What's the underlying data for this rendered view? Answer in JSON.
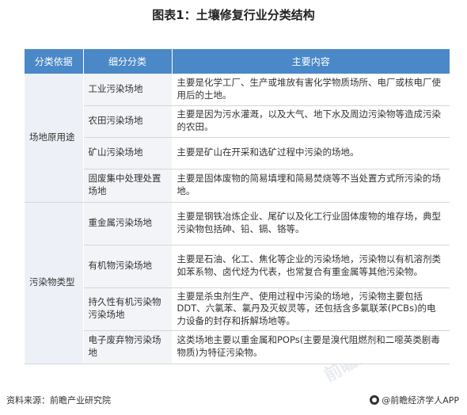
{
  "title": "图表1：土壤修复行业分类结构",
  "table": {
    "headers": [
      "分类依据",
      "细分分类",
      "主要内容"
    ],
    "groups": [
      {
        "label": "场地原用途",
        "rows": [
          {
            "sub": "工业污染场地",
            "desc": "主要是化学工厂、生产或堆放有害化学物质场所、电厂或核电厂使用后的土地。"
          },
          {
            "sub": "农田污染场地",
            "desc": "主要是因为污水灌溉，以及大气、地下水及周边污染物等造成污染的农田。"
          },
          {
            "sub": "矿山污染场地",
            "desc": "主要是矿山在开采和选矿过程中污染的场地。"
          },
          {
            "sub": "固废集中处理处置场地",
            "desc": "主要是固体废物的简易填埋和简易焚烧等不当处置方式所污染的场地。"
          }
        ]
      },
      {
        "label": "污染物类型",
        "rows": [
          {
            "sub": "重金属污染场地",
            "desc": "主要是钢铁冶炼企业、尾矿以及化工行业固体废物的堆存场，典型污染物包括砷、铅、镉、铬等。"
          },
          {
            "sub": "有机物污染场地",
            "desc": "主要是石油、化工、焦化等企业的污染场地，污染物以有机溶剂类如苯系物、卤代烃为代表，也常复合有重金属等其他污染物。"
          },
          {
            "sub": "持久性有机污染物污染场地",
            "desc": "主要是杀虫剂生产、使用过程中污染的场地，污染物主要包括DDT、六氯苯、氯丹及灭蚁灵等，还包括含多氯联苯(PCBs)的电力设备的封存和拆解场地等。"
          },
          {
            "sub": "电子废弃物污染场地",
            "desc": "这类场地主要以重金属和POPs(主要是溴代阻燃剂和二噁英类剧毒物质)为特征污染物。"
          }
        ]
      }
    ]
  },
  "footer": {
    "source": "资料来源：前瞻产业研究院",
    "brand": "@前瞻经济学人APP"
  },
  "colors": {
    "header_bg": "#4a88c7",
    "group_bg": "#edf1f7",
    "sub_bg": "#f2f4f7"
  }
}
